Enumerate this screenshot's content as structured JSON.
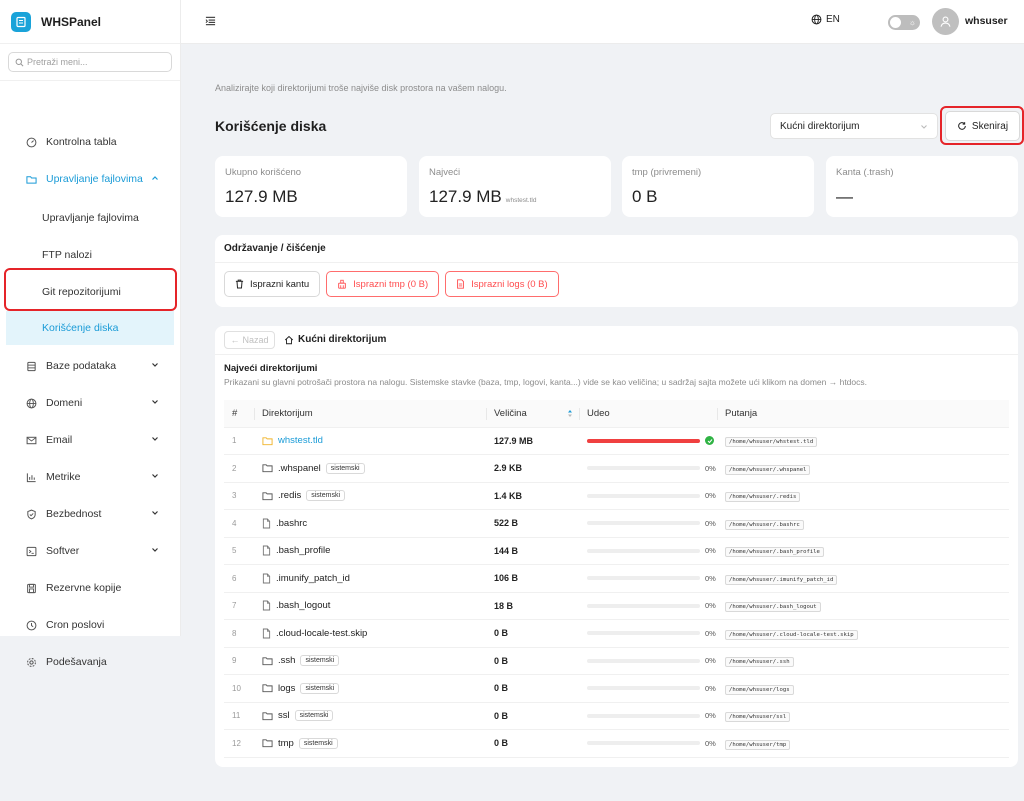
{
  "brand": {
    "name": "WHSPanel",
    "color": "#1aa3d9"
  },
  "sidebar": {
    "search_placeholder": "Pretraži meni...",
    "items": [
      {
        "label": "Kontrolna tabla",
        "icon": "dashboard-icon"
      },
      {
        "label": "Upravljanje fajlovima",
        "icon": "folder-icon",
        "expanded": true
      },
      {
        "label": "Upravljanje fajlovima",
        "sub": true
      },
      {
        "label": "FTP nalozi",
        "sub": true
      },
      {
        "label": "Git repozitorijumi",
        "sub": true
      },
      {
        "label": "Korišćenje diska",
        "sub": true,
        "selected": true
      },
      {
        "label": "Baze podataka",
        "icon": "database-icon"
      },
      {
        "label": "Domeni",
        "icon": "globe-icon"
      },
      {
        "label": "Email",
        "icon": "mail-icon"
      },
      {
        "label": "Metrike",
        "icon": "chart-icon"
      },
      {
        "label": "Bezbednost",
        "icon": "shield-icon"
      },
      {
        "label": "Softver",
        "icon": "terminal-icon"
      },
      {
        "label": "Rezervne kopije",
        "icon": "backup-icon"
      },
      {
        "label": "Cron poslovi",
        "icon": "clock-icon"
      },
      {
        "label": "Podešavanja",
        "icon": "gear-icon"
      }
    ]
  },
  "topbar": {
    "language": "EN",
    "username": "whsuser"
  },
  "page": {
    "intro": "Analizirajte koji direktorijumi troše najviše disk prostora na vašem nalogu.",
    "title": "Korišćenje diska",
    "directory_select": "Kućni direktorijum",
    "scan_label": "Skeniraj"
  },
  "stats": [
    {
      "label": "Ukupno korišćeno",
      "value": "127.9 MB",
      "sub": ""
    },
    {
      "label": "Najveći",
      "value": "127.9 MB",
      "sub": "whstest.tld"
    },
    {
      "label": "tmp (privremeni)",
      "value": "0 B",
      "sub": ""
    },
    {
      "label": "Kanta (.trash)",
      "value": "—",
      "sub": ""
    }
  ],
  "maintenance": {
    "title": "Održavanje / čišćenje",
    "buttons": [
      {
        "label": "Isprazni kantu",
        "style": "plain"
      },
      {
        "label": "Isprazni tmp (0 B)",
        "style": "danger"
      },
      {
        "label": "Isprazni logs (0 B)",
        "style": "danger"
      }
    ]
  },
  "browser": {
    "back_label": "Nazad",
    "breadcrumb": "Kućni direktorijum",
    "section_title": "Najveći direktorijumi",
    "section_desc": "Prikazani su glavni potrošači prostora na nalogu. Sistemske stavke (baza, tmp, logovi, kanta...) vide se kao veličina; u sadržaj sajta možete ući klikom na domen → htdocs.",
    "columns": [
      "#",
      "Direktorijum",
      "Veličina",
      "Udeo",
      "Putanja"
    ],
    "rows": [
      {
        "n": "1",
        "name": "whstest.tld",
        "type": "folder",
        "tag": "",
        "link": true,
        "size": "127.9 MB",
        "share": 1.0,
        "pct": "",
        "path": "/home/whsuser/whstest.tld"
      },
      {
        "n": "2",
        "name": ".whspanel",
        "type": "folder",
        "tag": "sistemski",
        "size": "2.9 KB",
        "share": 0,
        "pct": "0%",
        "path": "/home/whsuser/.whspanel"
      },
      {
        "n": "3",
        "name": ".redis",
        "type": "folder",
        "tag": "sistemski",
        "size": "1.4 KB",
        "share": 0,
        "pct": "0%",
        "path": "/home/whsuser/.redis"
      },
      {
        "n": "4",
        "name": ".bashrc",
        "type": "file",
        "tag": "",
        "size": "522 B",
        "share": 0,
        "pct": "0%",
        "path": "/home/whsuser/.bashrc"
      },
      {
        "n": "5",
        "name": ".bash_profile",
        "type": "file",
        "tag": "",
        "size": "144 B",
        "share": 0,
        "pct": "0%",
        "path": "/home/whsuser/.bash_profile"
      },
      {
        "n": "6",
        "name": ".imunify_patch_id",
        "type": "file",
        "tag": "",
        "size": "106 B",
        "share": 0,
        "pct": "0%",
        "path": "/home/whsuser/.imunify_patch_id"
      },
      {
        "n": "7",
        "name": ".bash_logout",
        "type": "file",
        "tag": "",
        "size": "18 B",
        "share": 0,
        "pct": "0%",
        "path": "/home/whsuser/.bash_logout"
      },
      {
        "n": "8",
        "name": ".cloud-locale-test.skip",
        "type": "file",
        "tag": "",
        "size": "0 B",
        "share": 0,
        "pct": "0%",
        "path": "/home/whsuser/.cloud-locale-test.skip"
      },
      {
        "n": "9",
        "name": ".ssh",
        "type": "folder",
        "tag": "sistemski",
        "size": "0 B",
        "share": 0,
        "pct": "0%",
        "path": "/home/whsuser/.ssh"
      },
      {
        "n": "10",
        "name": "logs",
        "type": "folder",
        "tag": "sistemski",
        "size": "0 B",
        "share": 0,
        "pct": "0%",
        "path": "/home/whsuser/logs"
      },
      {
        "n": "11",
        "name": "ssl",
        "type": "folder",
        "tag": "sistemski",
        "size": "0 B",
        "share": 0,
        "pct": "0%",
        "path": "/home/whsuser/ssl"
      },
      {
        "n": "12",
        "name": "tmp",
        "type": "folder",
        "tag": "sistemski",
        "size": "0 B",
        "share": 0,
        "pct": "0%",
        "path": "/home/whsuser/tmp"
      }
    ]
  },
  "colors": {
    "accent": "#1a9bd7",
    "danger": "#ff4d4f",
    "highlight": "#e52429",
    "bar": "#f04040",
    "ok": "#2fb344"
  }
}
